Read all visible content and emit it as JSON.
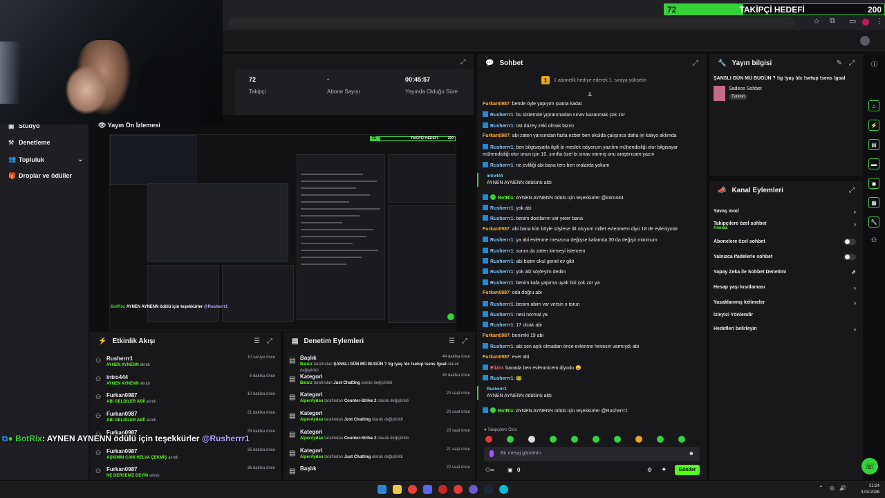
{
  "follow_goal": {
    "title": "TAKİPÇİ HEDEFİ",
    "current": "72",
    "target": "200",
    "progress": 0.36
  },
  "preview_mini_goal": {
    "current": "72",
    "title": "TAKİPÇİ HEDEFİ",
    "target": "200"
  },
  "stats": [
    {
      "value": "72",
      "label": "Takipçi"
    },
    {
      "value": "-",
      "label": "Abone Sayısı"
    },
    {
      "value": "00:45:57",
      "label": "Yayında Olduğu Süre"
    }
  ],
  "nav": {
    "studio": "Stüdyo",
    "moderation": "Denetleme",
    "community": "Topluluk",
    "drops": "Droplar ve ödüller"
  },
  "preview": {
    "title": "Yayın Ön İzlemesi",
    "overlay_bot": "BotRix",
    "overlay_text": ": AYNEN AYNENN ödülü için teşekkürler",
    "overlay_mention": "@Rusherrr1"
  },
  "activity": {
    "title": "Etkinlik Akışı",
    "items": [
      {
        "name": "Rusherrr1",
        "reward": "AYNEN AYNENN",
        "suffix": "alındı",
        "time": "10 saniye önce"
      },
      {
        "name": "intro444",
        "reward": "AYNEN AYNENN",
        "suffix": "alındı",
        "time": "6 dakika önce"
      },
      {
        "name": "Furkan0987",
        "reward": "ABİ GELDİLER ABİİ",
        "suffix": "alındı",
        "time": "10 dakika önce"
      },
      {
        "name": "Furkan0987",
        "reward": "ABİ GELDİLER ABİİ",
        "suffix": "alındı",
        "time": "21 dakika önce"
      },
      {
        "name": "Furkan0987",
        "reward": "",
        "suffix": "",
        "time": "29 dakika önce"
      },
      {
        "name": "Furkan0987",
        "reward": "AŞKIMIN CANI HELVA ÇEKMİŞ",
        "suffix": "alındı",
        "time": "35 dakika önce"
      },
      {
        "name": "Furkan0987",
        "reward": "NE DERSENİZ DEYİN",
        "suffix": "alındı",
        "time": "36 dakika önce"
      }
    ]
  },
  "moderation": {
    "title": "Denetim Eylemleri",
    "items": [
      {
        "name": "Başlık",
        "actor": "Batuiz",
        "mid": "tarafından",
        "value": "ŞANSLI GÜN MÜ BUGÜN ? !ig !yaş !dc !setup !sens !goal",
        "tail": "olarak değiştirildi",
        "time": "44 dakika önce"
      },
      {
        "name": "Kategori",
        "actor": "Batuiz",
        "mid": "tarafından",
        "value": "Just Chatting",
        "tail": "olarak değiştirildi",
        "time": "45 dakika önce"
      },
      {
        "name": "Kategori",
        "actor": "AlperAydan",
        "mid": "tarafından",
        "value": "Counter-Strike 2",
        "tail": "olarak değiştirildi",
        "time": "20 saat önce"
      },
      {
        "name": "Kategori",
        "actor": "AlperAydan",
        "mid": "tarafından",
        "value": "Just Chatting",
        "tail": "olarak değiştirildi",
        "time": "20 saat önce"
      },
      {
        "name": "Kategori",
        "actor": "AlperAydan",
        "mid": "tarafından",
        "value": "Counter-Strike 2",
        "tail": "olarak değiştirildi",
        "time": "20 saat önce"
      },
      {
        "name": "Kategori",
        "actor": "AlperAydan",
        "mid": "tarafından",
        "value": "Just Chatting",
        "tail": "olarak değiştirildi",
        "time": "21 saat önce"
      },
      {
        "name": "Başlık",
        "actor": "",
        "mid": "",
        "value": "",
        "tail": "",
        "time": "22 saat önce"
      }
    ]
  },
  "chat": {
    "title": "Sohbet",
    "pinned": "1 abonelik hediye ederek 1. sıraya yükselin",
    "followers_only": "Takipçilere Özel",
    "placeholder": "Bir mesaj gönderin",
    "send": "Gönder",
    "points": "0",
    "messages": [
      {
        "u": "Furkan0987",
        "c": "u-furkan",
        "b": "",
        "t": ": bende öyle yapıyım şuana kadat"
      },
      {
        "u": "Rusherrr1",
        "c": "u-rush",
        "b": "k",
        "t": ": bu sistemde yıpranmadan sınav kazanmak çok zor"
      },
      {
        "u": "Rusherrr1",
        "c": "u-rush",
        "b": "k",
        "t": ": üst düzey zeki olmak lazım"
      },
      {
        "u": "Furkan0987",
        "c": "u-furkan",
        "b": "",
        "t": ": abi zaten yarısından fazla ezber ben okulda çalışınca daha iyi kalıyo aklımda"
      },
      {
        "u": "Rusherrr1",
        "c": "u-rush",
        "b": "k",
        "t": ": ben bilgisayarla ilgili bi meslek istiyorum yazılım mühendisliği olur bilgisayar mühendisliği olur onun için 10. sınıfta özel bi sınav varmış onu araştırıcam yazın"
      },
      {
        "u": "Rusherrr1",
        "c": "u-rush",
        "b": "k",
        "t": ": ne evliliği abi bana ters ben oralarda yokum"
      },
      {
        "u": "intro444",
        "c": "u-intro",
        "b": "",
        "t": "AYNEN AYNENN ödülünü aldı",
        "redeem": true
      },
      {
        "u": "BotRix",
        "c": "u-bot",
        "b": "kg",
        "t": ": AYNEN AYNENN ödülü için teşekkürler @intro444"
      },
      {
        "u": "Rusherrr1",
        "c": "u-rush",
        "b": "k",
        "t": ": yok abi"
      },
      {
        "u": "Rusherrr1",
        "c": "u-rush",
        "b": "k",
        "t": ": benim dostlarım var yeter bana"
      },
      {
        "u": "Furkan0987",
        "c": "u-furkan",
        "b": "",
        "t": ": abi bana kim böyle söylese tilt oluyom millet evlenmem diyo 18 de evleniyolar"
      },
      {
        "u": "Rusherrr1",
        "c": "u-rush",
        "b": "k",
        "t": ": ya abi evlenme mevzusu değişse kafamda 30 da değişir minimum"
      },
      {
        "u": "Rusherrr1",
        "c": "u-rush",
        "b": "k",
        "t": ": sonra da zaten kimseyi istemem"
      },
      {
        "u": "Rusherrr1",
        "c": "u-rush",
        "b": "k",
        "t": ": abi bizim okul genel ev gibi"
      },
      {
        "u": "Rusherrr1",
        "c": "u-rush",
        "b": "k",
        "t": ": yok abi söyleyim dedim"
      },
      {
        "u": "Rusherrr1",
        "c": "u-rush",
        "b": "k",
        "t": ": benim kafa yapıma uyak biri çok zor ya"
      },
      {
        "u": "Furkan0987",
        "c": "u-furkan",
        "b": "",
        "t": ": oda doğru abi"
      },
      {
        "u": "Rusherrr1",
        "c": "u-rush",
        "b": "k",
        "t": ": benim abim var versin o torun"
      },
      {
        "u": "Rusherrr1",
        "c": "u-rush",
        "b": "k",
        "t": ": nesi normal ya"
      },
      {
        "u": "Rusherrr1",
        "c": "u-rush",
        "b": "k",
        "t": ": 17 olcak abi"
      },
      {
        "u": "Furkan0987",
        "c": "u-furkan",
        "b": "",
        "t": ": benimki 19 abi"
      },
      {
        "u": "Rusherrr1",
        "c": "u-rush",
        "b": "k",
        "t": ": abi sen aşık olmadan önce evlenme hevesin varmıydı abi"
      },
      {
        "u": "Furkan0987",
        "c": "u-furkan",
        "b": "",
        "t": ": evet abi"
      },
      {
        "u": "Elizin",
        "c": "u-elizin",
        "b": "k",
        "t": ": banada ben evlenmicem diyodu 😄"
      },
      {
        "u": "Rusherrr1",
        "c": "u-rush",
        "b": "k",
        "t": ": 🐸"
      },
      {
        "u": "Rusherrr1",
        "c": "u-rush",
        "b": "",
        "t": "AYNEN AYNENN ödülünü aldı",
        "redeem": true
      },
      {
        "u": "BotRix",
        "c": "u-bot",
        "b": "kg",
        "t": ": AYNEN AYNENN ödülü için teşekkürler @Rusherrr1"
      }
    ]
  },
  "stream_info": {
    "title": "Yayın bilgisi",
    "stream_title": "ŞANSLI GÜN MÜ BUGÜN ? !ig !yaş !dc !setup !sens !goal",
    "category": "Sadece Sohbet",
    "tag": "Turkish"
  },
  "channel_actions": {
    "title": "Kanal Eylemleri",
    "items": [
      {
        "label": "Yavaş mod",
        "sub": "",
        "type": "chevron"
      },
      {
        "label": "Takipçilere özel sohbet",
        "sub": "Anında",
        "type": "chevron"
      },
      {
        "label": "Abonelere özel sohbet",
        "sub": "",
        "type": "toggle"
      },
      {
        "label": "Yalnızca ifadelerle sohbet",
        "sub": "",
        "type": "toggle"
      },
      {
        "label": "Yapay Zeka ile Sohbet Denetimi",
        "sub": "",
        "type": "external"
      },
      {
        "label": "Hesap yaşı kısıtlaması",
        "sub": "",
        "type": "chevron"
      },
      {
        "label": "Yasaklanmış kelimeler",
        "sub": "",
        "type": "chevron"
      },
      {
        "label": "İzleyici Yönlendir",
        "sub": "",
        "type": "none"
      },
      {
        "label": "Hedefleri belirleyin",
        "sub": "",
        "type": "chevron"
      }
    ]
  },
  "clock": {
    "time": "21:24",
    "date": "3.04.2026"
  },
  "colors": {
    "accent": "#53fc18",
    "goal_green": "#35d23a",
    "panel": "#18181b",
    "bg": "#0e0e10"
  }
}
